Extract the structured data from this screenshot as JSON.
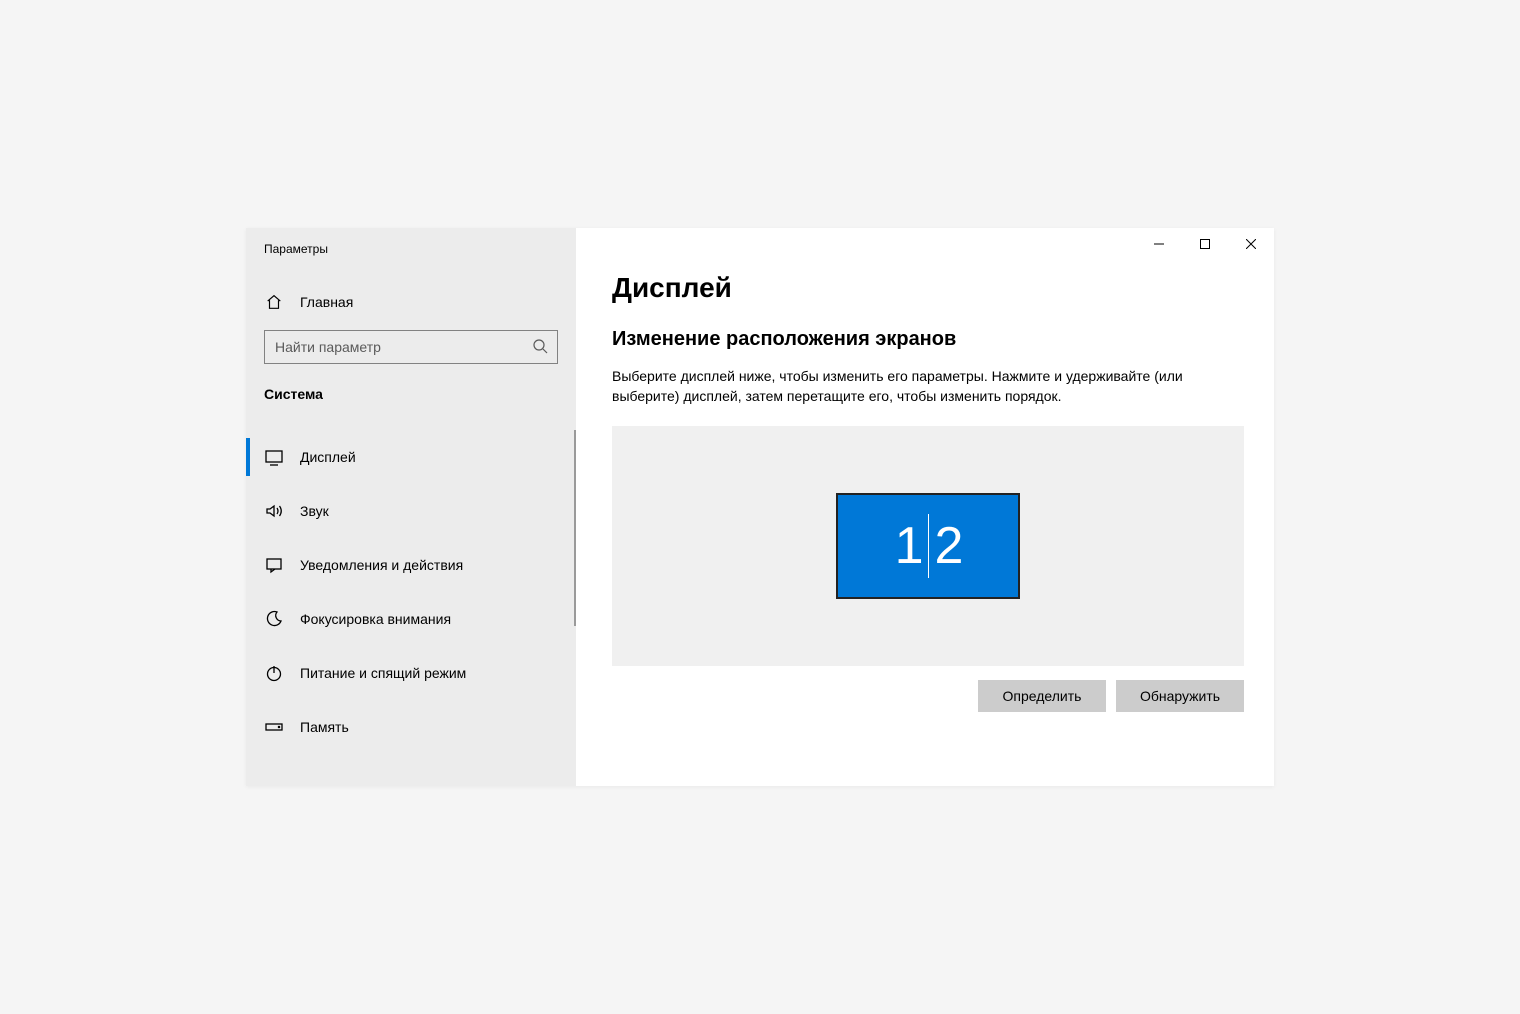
{
  "window": {
    "title": "Параметры"
  },
  "sidebar": {
    "home_label": "Главная",
    "search_placeholder": "Найти параметр",
    "category_label": "Система",
    "items": [
      {
        "label": "Дисплей"
      },
      {
        "label": "Звук"
      },
      {
        "label": "Уведомления и действия"
      },
      {
        "label": "Фокусировка внимания"
      },
      {
        "label": "Питание и спящий режим"
      },
      {
        "label": "Память"
      }
    ]
  },
  "main": {
    "page_title": "Дисплей",
    "section_title": "Изменение расположения экранов",
    "section_desc": "Выберите дисплей ниже, чтобы изменить его параметры. Нажмите и удерживайте (или выберите) дисплей, затем перетащите его, чтобы изменить порядок.",
    "monitor_label_1": "1",
    "monitor_label_2": "2",
    "identify_label": "Определить",
    "detect_label": "Обнаружить"
  }
}
